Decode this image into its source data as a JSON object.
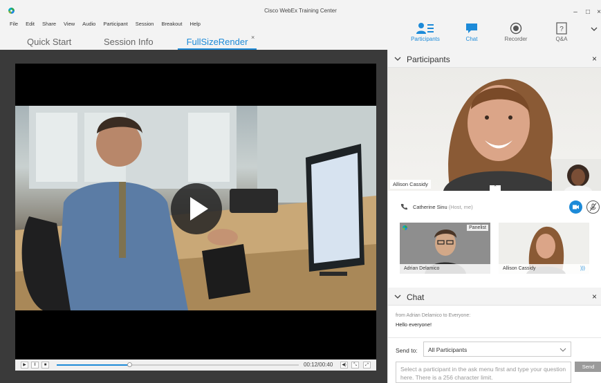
{
  "window": {
    "title": "Cisco WebEx Training Center",
    "controls": [
      "–",
      "□",
      "×"
    ]
  },
  "menu": [
    "File",
    "Edit",
    "Share",
    "View",
    "Audio",
    "Participant",
    "Session",
    "Breakout",
    "Help"
  ],
  "tabs": [
    {
      "label": "Quick Start",
      "active": false
    },
    {
      "label": "Session Info",
      "active": false
    },
    {
      "label": "FullSizeRender",
      "active": true,
      "close": "×"
    }
  ],
  "toolbar": [
    {
      "label": "Participants",
      "icon": "participants-icon",
      "active": true
    },
    {
      "label": "Chat",
      "icon": "chat-icon",
      "active": true
    },
    {
      "label": "Recorder",
      "icon": "recorder-icon",
      "active": false
    },
    {
      "label": "Q&A",
      "icon": "qa-icon",
      "active": false
    }
  ],
  "player": {
    "time": "00:12/00:40",
    "progress": 0.3
  },
  "participants_panel": {
    "title": "Participants",
    "close": "×",
    "active_speaker": "Allison Cassidy",
    "host_name": "Catherine Sinu",
    "host_role": "(Host, me)",
    "tiles": [
      {
        "name": "Adrian Delamico",
        "badge": "Panelist"
      },
      {
        "name": "Allison Cassidy",
        "badge": ""
      }
    ]
  },
  "chat_panel": {
    "title": "Chat",
    "close": "×",
    "from": "from Adrian Delamico to Everyone:",
    "message": "Hello everyone!",
    "send_to_label": "Send to:",
    "send_to_value": "All Participants",
    "input_placeholder": "Select a participant in the ask menu first and type your question here. There is a 256 character limit.",
    "send_label": "Send"
  },
  "colors": {
    "accent": "#1c8ad8",
    "chrome": "#f3f3f3",
    "video_bg": "#3a3a3a"
  }
}
